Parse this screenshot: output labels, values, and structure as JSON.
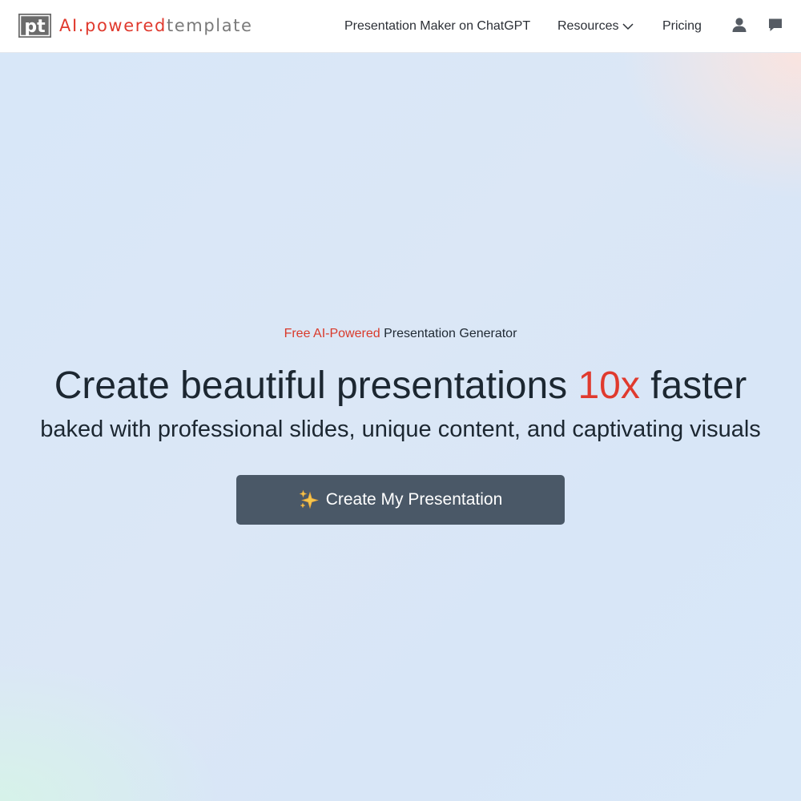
{
  "header": {
    "logo": {
      "icon": "pt-logo-icon",
      "mark_text": "pt",
      "ai_text": "AI.powered",
      "template_text": "template"
    },
    "nav": {
      "chatgpt_label": "Presentation Maker on ChatGPT",
      "resources_label": "Resources",
      "pricing_label": "Pricing"
    },
    "icons": [
      "user-icon",
      "chat-icon",
      "chevron-down-icon"
    ]
  },
  "hero": {
    "eyebrow_accent": "Free AI-Powered",
    "eyebrow_rest": " Presentation Generator",
    "headline_pre": "Create beautiful presentations ",
    "headline_accent": "10x",
    "headline_post": " faster",
    "subline": "baked with professional slides, unique content, and captivating visuals",
    "cta_label": "Create My Presentation",
    "cta_icon": "sparkles-icon"
  },
  "colors": {
    "accent": "#e03a2e",
    "button": "#4a5867",
    "text": "#1c2731"
  }
}
